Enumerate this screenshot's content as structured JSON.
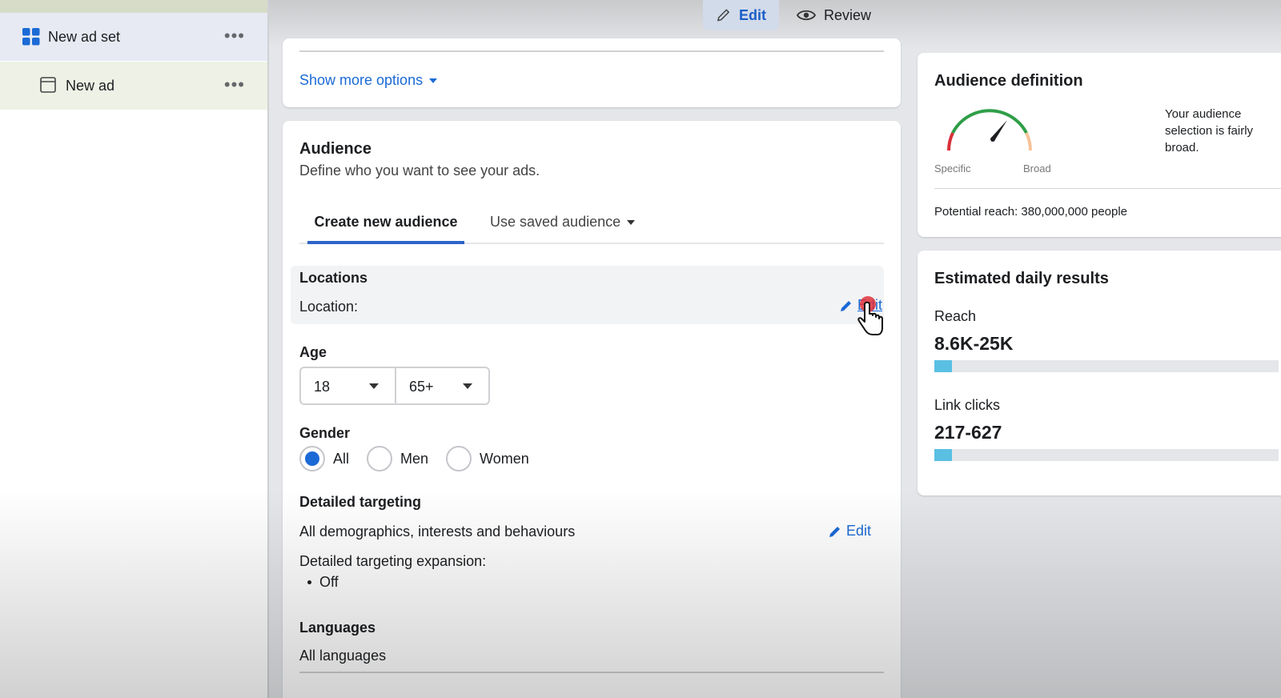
{
  "sidebar": {
    "items": [
      {
        "label": "New ad set",
        "icon": "grid-icon"
      },
      {
        "label": "New ad",
        "icon": "ad-page-icon"
      }
    ],
    "more_icon": "•••"
  },
  "toptabs": {
    "edit": "Edit",
    "review": "Review"
  },
  "options_card": {
    "show_more": "Show more options"
  },
  "audience": {
    "title": "Audience",
    "subtitle": "Define who you want to see your ads.",
    "tabs": {
      "create": "Create new audience",
      "saved": "Use saved audience"
    },
    "locations": {
      "heading": "Locations",
      "label": "Location:",
      "edit": "Edit"
    },
    "age": {
      "heading": "Age",
      "min": "18",
      "max": "65+"
    },
    "gender": {
      "heading": "Gender",
      "options": [
        "All",
        "Men",
        "Women"
      ],
      "selected": "All"
    },
    "detailed": {
      "heading": "Detailed targeting",
      "value": "All demographics, interests and behaviours",
      "edit": "Edit",
      "expansion_label": "Detailed targeting expansion:",
      "expansion_value": "Off"
    },
    "languages": {
      "heading": "Languages",
      "value": "All languages"
    }
  },
  "audience_definition": {
    "title": "Audience definition",
    "specific": "Specific",
    "broad": "Broad",
    "description": "Your audience selection is fairly broad.",
    "potential_reach": "Potential reach: 380,000,000 people"
  },
  "estimated": {
    "title": "Estimated daily results",
    "reach_label": "Reach",
    "reach_value": "8.6K-25K",
    "reach_fill": 0.05,
    "clicks_label": "Link clicks",
    "clicks_value": "217-627",
    "clicks_fill": 0.05
  },
  "colors": {
    "accent": "#1b6ad6",
    "bar": "#5ac0e3"
  }
}
